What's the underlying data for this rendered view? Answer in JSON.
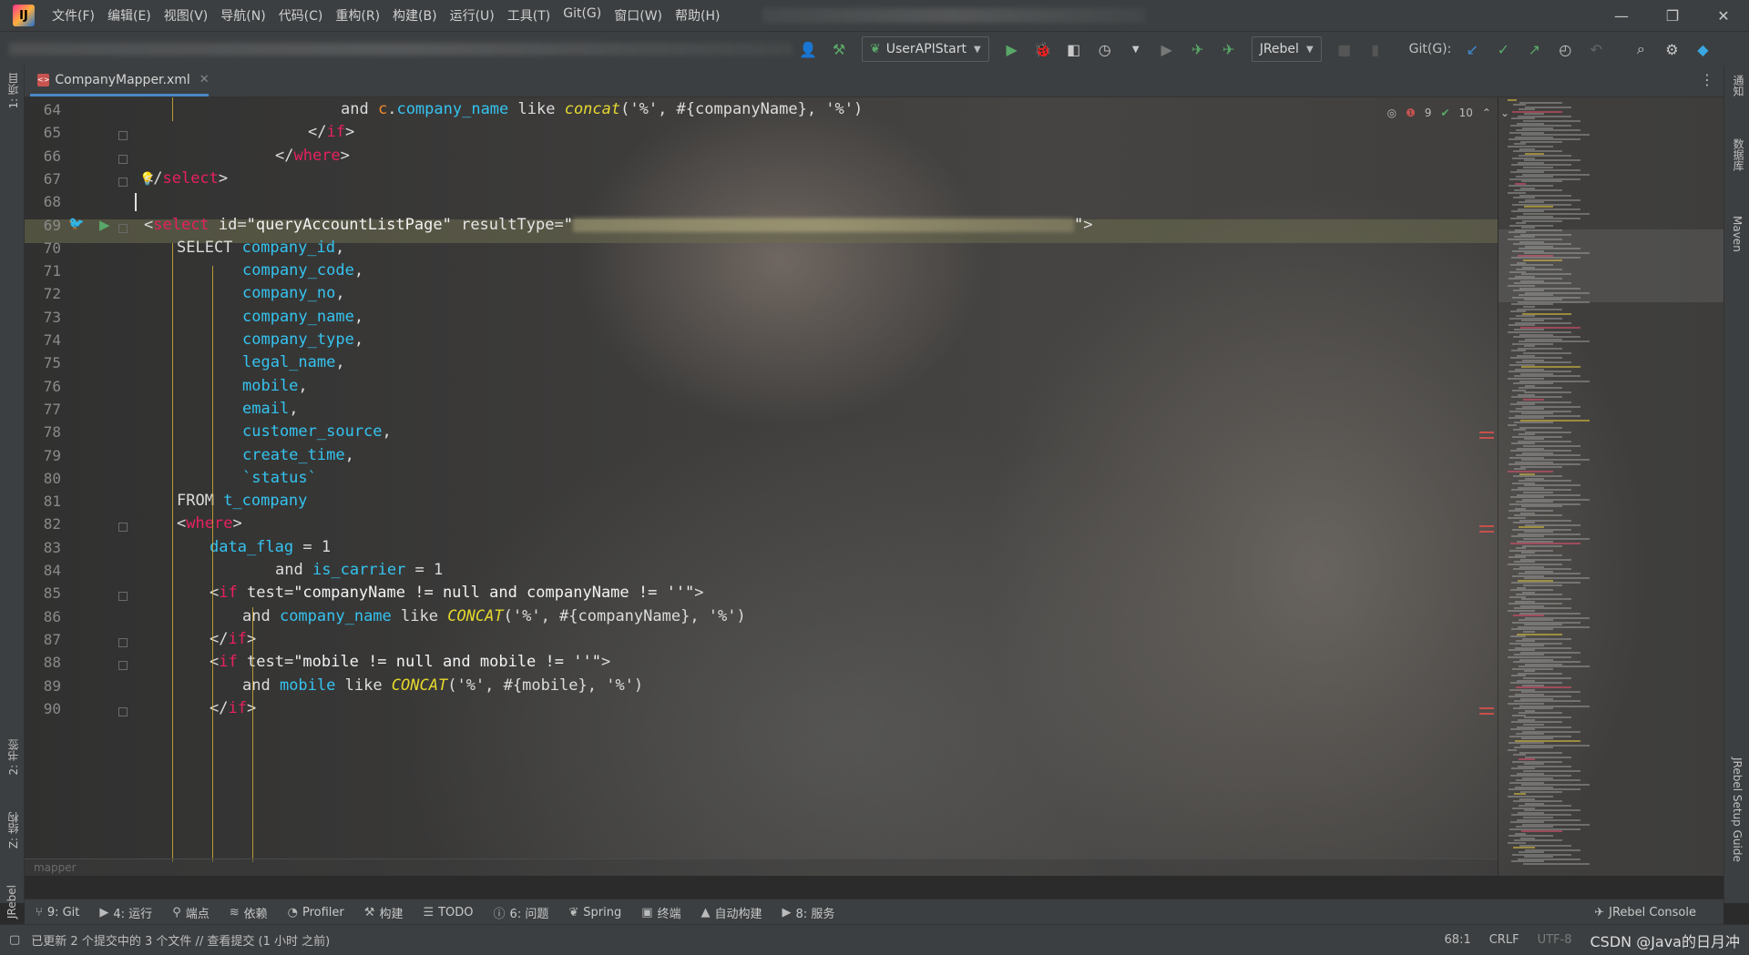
{
  "menu": [
    "文件(F)",
    "编辑(E)",
    "视图(V)",
    "导航(N)",
    "代码(C)",
    "重构(R)",
    "构建(B)",
    "运行(U)",
    "工具(T)",
    "Git(G)",
    "窗口(W)",
    "帮助(H)"
  ],
  "window_controls": {
    "minimize": "—",
    "restore": "❐",
    "close": "✕"
  },
  "toolbar": {
    "run_config": "UserAPIStart",
    "jrebel_combo": "JRebel",
    "git_label": "Git(G):"
  },
  "left_strip": {
    "project": "1: 项目",
    "bookmarks": "2: 书签",
    "structure": "Z: 结构",
    "jrebel": "JRebel"
  },
  "right_strip": {
    "notifications": "通知",
    "database": "数据库",
    "maven": "Maven",
    "jrebel_setup": "JRebel Setup Guide"
  },
  "tab": {
    "title": "CompanyMapper.xml"
  },
  "inspections": {
    "errors": "9",
    "checks": "10"
  },
  "editor": {
    "breadcrumb": "mapper",
    "lines": [
      {
        "n": "64",
        "indent": 6,
        "html": "and <span class='alias'>c</span>.<span class='col'>company_name</span> like <span class='fn'>concat</span>('%', #{companyName}, '%')"
      },
      {
        "n": "65",
        "indent": 5,
        "html": "&lt;/<span class='tag'>if</span>&gt;"
      },
      {
        "n": "66",
        "indent": 4,
        "html": "&lt;/<span class='tag'>where</span>&gt;"
      },
      {
        "n": "67",
        "indent": 0,
        "html": "&lt;/<span class='tag'>select</span>&gt;"
      },
      {
        "n": "68",
        "indent": 0,
        "html": ""
      },
      {
        "n": "69",
        "indent": 0,
        "html": "&lt;<span class='tag'>select</span> <span class='attr'>id</span>=<span class='str'>\"queryAccountListPage\"</span> <span class='attr'>resultType</span>=<span class='str'>\"</span><span class='blurtext'></span><span class='str'>\"</span>&gt;"
      },
      {
        "n": "70",
        "indent": 1,
        "html": "SELECT <span class='col'>company_id</span>,"
      },
      {
        "n": "71",
        "indent": 3,
        "html": "<span class='col'>company_code</span>,"
      },
      {
        "n": "72",
        "indent": 3,
        "html": "<span class='col'>company_no</span>,"
      },
      {
        "n": "73",
        "indent": 3,
        "html": "<span class='col'>company_name</span>,"
      },
      {
        "n": "74",
        "indent": 3,
        "html": "<span class='col'>company_type</span>,"
      },
      {
        "n": "75",
        "indent": 3,
        "html": "<span class='col'>legal_name</span>,"
      },
      {
        "n": "76",
        "indent": 3,
        "html": "<span class='col'>mobile</span>,"
      },
      {
        "n": "77",
        "indent": 3,
        "html": "<span class='col'>email</span>,"
      },
      {
        "n": "78",
        "indent": 3,
        "html": "<span class='col'>customer_source</span>,"
      },
      {
        "n": "79",
        "indent": 3,
        "html": "<span class='col'>create_time</span>,"
      },
      {
        "n": "80",
        "indent": 3,
        "html": "<span class='col'>`status`</span>"
      },
      {
        "n": "81",
        "indent": 1,
        "html": "FROM <span class='col'>t_company</span>"
      },
      {
        "n": "82",
        "indent": 1,
        "html": "&lt;<span class='tag'>where</span>&gt;"
      },
      {
        "n": "83",
        "indent": 2,
        "html": "<span class='col'>data_flag</span> = 1"
      },
      {
        "n": "84",
        "indent": 4,
        "html": "and <span class='col'>is_carrier</span> = 1"
      },
      {
        "n": "85",
        "indent": 2,
        "html": "&lt;<span class='tag'>if</span> <span class='attr'>test</span>=<span class='str'>\"companyName != null and companyName != ''\"</span>&gt;"
      },
      {
        "n": "86",
        "indent": 3,
        "html": "and <span class='col'>company_name</span> like <span class='fn'>CONCAT</span>('%', #{companyName}, '%')"
      },
      {
        "n": "87",
        "indent": 2,
        "html": "&lt;/<span class='tag'>if</span>&gt;"
      },
      {
        "n": "88",
        "indent": 2,
        "html": "&lt;<span class='tag'>if</span> <span class='attr'>test</span>=<span class='str'>\"mobile != null and mobile != ''\"</span>&gt;"
      },
      {
        "n": "89",
        "indent": 3,
        "html": "and <span class='col'>mobile</span> like <span class='fn'>CONCAT</span>('%', #{mobile}, '%')"
      },
      {
        "n": "90",
        "indent": 2,
        "html": "&lt;/<span class='tag'>if</span>&gt;"
      }
    ]
  },
  "tool_windows": [
    {
      "icon": "git-icon",
      "glyph": "⑂",
      "label": "9: Git"
    },
    {
      "icon": "run-icon",
      "glyph": "▶",
      "label": "4: 运行"
    },
    {
      "icon": "endpoints-icon",
      "glyph": "⚲",
      "label": "端点"
    },
    {
      "icon": "dependencies-icon",
      "glyph": "≋",
      "label": "依赖"
    },
    {
      "icon": "profiler-icon",
      "glyph": "◔",
      "label": "Profiler"
    },
    {
      "icon": "build-icon",
      "glyph": "⚒",
      "label": "构建"
    },
    {
      "icon": "todo-icon",
      "glyph": "☰",
      "label": "TODO"
    },
    {
      "icon": "problems-icon",
      "glyph": "ⓘ",
      "label": "6: 问题"
    },
    {
      "icon": "spring-icon",
      "glyph": "❦",
      "label": "Spring"
    },
    {
      "icon": "terminal-icon",
      "glyph": "▣",
      "label": "终端"
    },
    {
      "icon": "auto-build-icon",
      "glyph": "▲",
      "label": "自动构建"
    },
    {
      "icon": "services-icon",
      "glyph": "▶",
      "label": "8: 服务"
    }
  ],
  "jrebel_console": "JRebel Console",
  "status": {
    "message": "已更新 2 个提交中的 3 个文件 // 查看提交 (1 小时 之前)",
    "position": "68:1",
    "line_sep": "CRLF",
    "encoding": "UTF-8",
    "watermark": "CSDN @Java的日月冲"
  },
  "colors": {
    "accent": "#4a88c7",
    "tag": "#e8205e",
    "column": "#35c3ef",
    "function": "#e6d92e",
    "run": "#59a869"
  }
}
